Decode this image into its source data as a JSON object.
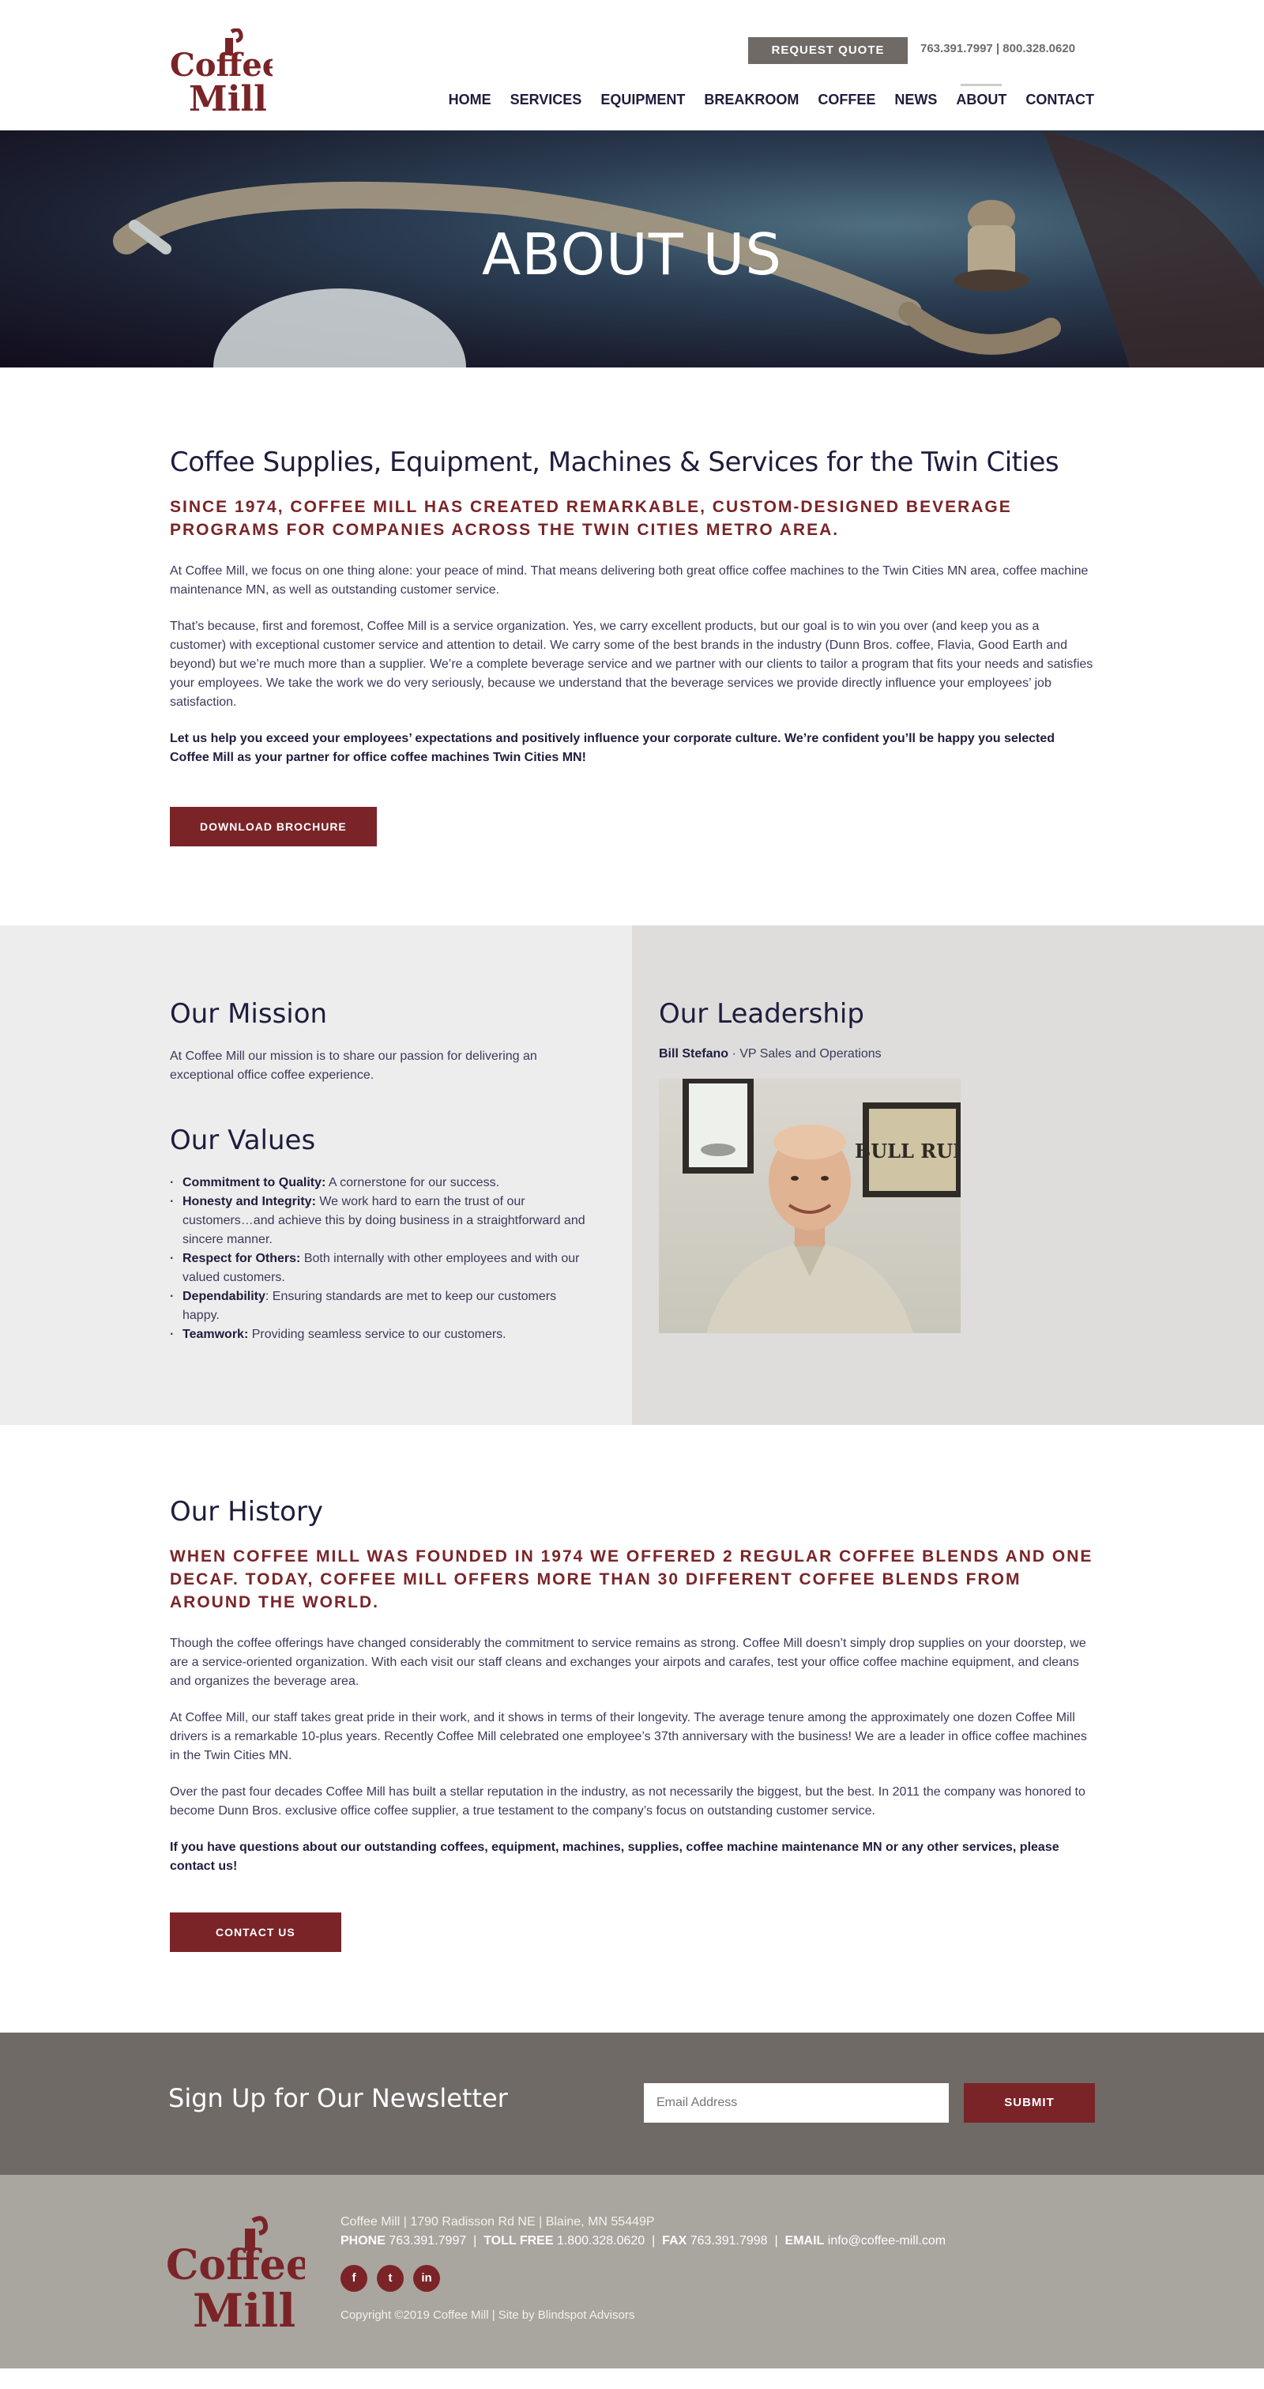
{
  "header": {
    "logo_text_1": "Coffee",
    "logo_text_2": "Mill",
    "quote_label": "REQUEST QUOTE",
    "phones": "763.391.7997 | 800.328.0620",
    "nav": [
      "HOME",
      "SERVICES",
      "EQUIPMENT",
      "BREAKROOM",
      "COFFEE",
      "NEWS",
      "ABOUT",
      "CONTACT"
    ],
    "active_nav": "ABOUT"
  },
  "hero": {
    "title": "ABOUT US"
  },
  "intro": {
    "title": "Coffee Supplies, Equipment, Machines & Services for the Twin Cities",
    "subhead": "SINCE 1974, COFFEE MILL HAS CREATED REMARKABLE, CUSTOM-DESIGNED BEVERAGE PROGRAMS FOR COMPANIES ACROSS THE TWIN CITIES METRO AREA.",
    "p1": "At Coffee Mill, we focus on one thing alone: your peace of mind. That means delivering both great office coffee machines to the Twin Cities MN area, coffee machine maintenance MN, as well as outstanding customer service.",
    "p2": "That’s because, first and foremost, Coffee Mill is a service organization. Yes, we carry excellent products, but our goal is to win you over (and keep you as a customer) with exceptional customer service and attention to detail. We carry some of the best brands in the industry (Dunn Bros. coffee, Flavia, Good Earth and beyond) but we’re much more than a supplier. We’re a complete beverage service and we partner with our clients to tailor a program that fits your needs and satisfies your employees. We take the work we do very seriously, because we understand that the beverage services we provide directly influence your employees’ job satisfaction.",
    "p3": "Let us help you exceed your employees’ expectations and positively influence your corporate culture. We’re confident you’ll be happy you selected Coffee Mill as your partner for office coffee machines Twin Cities MN!",
    "button": "DOWNLOAD BROCHURE"
  },
  "mission": {
    "title": "Our Mission",
    "text": "At Coffee Mill our mission is to share our passion for delivering an exceptional office coffee experience."
  },
  "values": {
    "title": "Our Values",
    "items": [
      {
        "label": "Commitment to Quality:",
        "text": " A cornerstone for our success."
      },
      {
        "label": "Honesty and Integrity:",
        "text": " We work hard to earn the trust of our customers…and achieve this by doing business in a straightforward and sincere manner."
      },
      {
        "label": "Respect for Others:",
        "text": " Both internally with other employees and with our valued customers."
      },
      {
        "label": "Dependability",
        "text": ": Ensuring standards are met to keep our customers happy."
      },
      {
        "label": "Teamwork:",
        "text": " Providing seamless service to our customers."
      }
    ]
  },
  "leadership": {
    "title": "Our Leadership",
    "name": "Bill Stefano",
    "role": "VP Sales and Operations",
    "poster_text": "BULL RUN"
  },
  "history": {
    "title": "Our History",
    "subhead": "WHEN COFFEE MILL WAS FOUNDED IN 1974 WE OFFERED 2 REGULAR COFFEE BLENDS AND ONE DECAF. TODAY, COFFEE MILL OFFERS MORE THAN 30 DIFFERENT COFFEE BLENDS FROM AROUND THE WORLD.",
    "p1": "Though the coffee offerings have changed considerably the commitment to service remains as strong. Coffee Mill doesn’t simply drop supplies on your doorstep, we are a service-oriented organization. With each visit our staff cleans and exchanges your airpots and carafes, test your office coffee machine equipment, and cleans and organizes the beverage area.",
    "p2": "At Coffee Mill, our staff takes great pride in their work, and it shows in terms of their longevity. The average tenure among the approximately one dozen Coffee Mill drivers is a remarkable 10-plus years. Recently Coffee Mill celebrated one employee’s 37th anniversary with the business! We are a leader in office coffee machines in the Twin Cities MN.",
    "p3": "Over the past four decades Coffee Mill has built a stellar reputation in the industry, as not necessarily the biggest, but the best. In 2011 the company was honored to become Dunn Bros. exclusive office coffee supplier, a true testament to the company’s focus on outstanding customer service.",
    "p4": "If you have questions about our outstanding coffees, equipment, machines, supplies, coffee machine maintenance MN or any other services, please contact us!",
    "button": "CONTACT US"
  },
  "newsletter": {
    "title": "Sign Up for Our Newsletter",
    "placeholder": "Email Address",
    "submit": "SUBMIT"
  },
  "footer": {
    "address": "Coffee Mill  |  1790 Radisson Rd NE  |  Blaine, MN 55449P",
    "phone_label": "PHONE",
    "phone": "763.391.7997",
    "tollfree_label": "TOLL FREE",
    "tollfree": "1.800.328.0620",
    "fax_label": "FAX",
    "fax": "763.391.7998",
    "email_label": "EMAIL",
    "email": "info@coffee-mill.com",
    "social": [
      "f",
      "t",
      "in"
    ],
    "copyright": "Copyright ©2019 Coffee Mill  |  Site by Blindspot Advisors"
  },
  "colors": {
    "brand_red": "#7a2428",
    "navy_text": "#1f1d3d",
    "gray_button": "#6f6a66",
    "footer_bg": "#a9a59f"
  }
}
